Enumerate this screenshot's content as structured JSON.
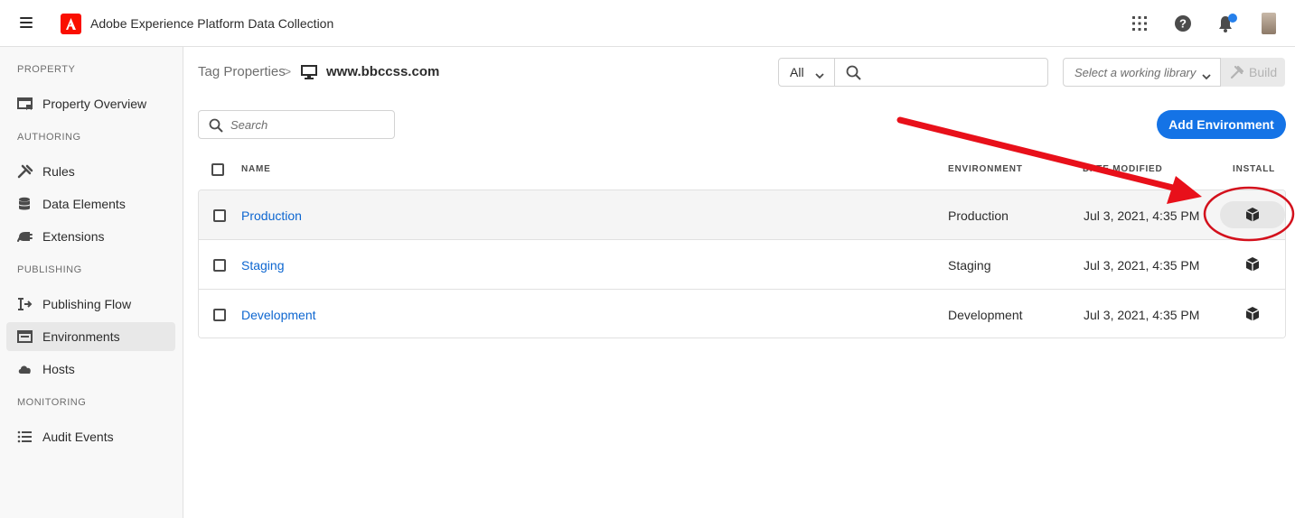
{
  "topbar": {
    "app_title": "Adobe Experience Platform Data Collection",
    "icons": [
      "menu-icon",
      "adobe-logo",
      "apps-grid-icon",
      "help-icon",
      "notifications-bell-icon",
      "user-avatar"
    ]
  },
  "sidebar": {
    "sections": [
      {
        "label": "PROPERTY",
        "items": [
          {
            "label": "Property Overview",
            "icon": "property-overview-icon"
          }
        ]
      },
      {
        "label": "AUTHORING",
        "items": [
          {
            "label": "Rules",
            "icon": "rules-icon"
          },
          {
            "label": "Data Elements",
            "icon": "data-elements-icon"
          },
          {
            "label": "Extensions",
            "icon": "extensions-icon"
          }
        ]
      },
      {
        "label": "PUBLISHING",
        "items": [
          {
            "label": "Publishing Flow",
            "icon": "publishing-flow-icon"
          },
          {
            "label": "Environments",
            "icon": "environments-icon",
            "active": true
          },
          {
            "label": "Hosts",
            "icon": "hosts-cloud-icon"
          }
        ]
      },
      {
        "label": "MONITORING",
        "items": [
          {
            "label": "Audit Events",
            "icon": "audit-events-icon"
          }
        ]
      }
    ]
  },
  "breadcrumb": {
    "parent": "Tag Properties",
    "separator": ">",
    "current": "www.bbccss.com"
  },
  "filter": {
    "selected": "All",
    "search_placeholder": ""
  },
  "library": {
    "placeholder": "Select a working library",
    "build_label": "Build"
  },
  "table_search": {
    "placeholder": "Search"
  },
  "add_button": {
    "label": "Add Environment"
  },
  "table": {
    "headers": {
      "name": "NAME",
      "environment": "ENVIRONMENT",
      "modified": "DATE MODIFIED",
      "install": "INSTALL"
    },
    "rows": [
      {
        "name": "Production",
        "environment": "Production",
        "modified": "Jul 3, 2021, 4:35 PM",
        "install_icon": "install-package-icon"
      },
      {
        "name": "Staging",
        "environment": "Staging",
        "modified": "Jul 3, 2021, 4:35 PM",
        "install_icon": "install-package-icon"
      },
      {
        "name": "Development",
        "environment": "Development",
        "modified": "Jul 3, 2021, 4:35 PM",
        "install_icon": "install-package-icon"
      }
    ]
  },
  "colors": {
    "accent": "#1473e6",
    "link": "#0d66d0",
    "adobe_red": "#fa0f00",
    "annotation_red": "#e8101a",
    "notification_dot": "#2680eb"
  }
}
